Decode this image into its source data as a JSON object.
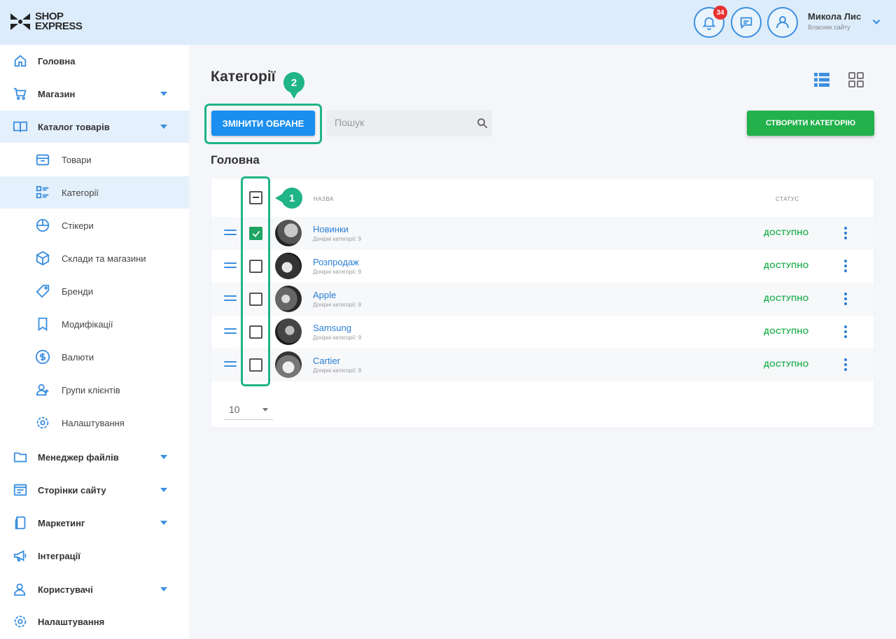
{
  "header": {
    "logo_line1": "SHOP",
    "logo_line2": "EXPRESS",
    "notifications_count": "34",
    "user_name": "Микола Лис",
    "user_subtitle": "Власник сайту",
    "icons": [
      "bell-icon",
      "chat-icon",
      "user-icon",
      "chevron-down-icon"
    ]
  },
  "sidebar": {
    "items": [
      {
        "label": "Головна",
        "icon": "home-icon"
      },
      {
        "label": "Магазин",
        "icon": "cart-icon",
        "expandable": true
      },
      {
        "label": "Каталог товарів",
        "icon": "book-icon",
        "expandable": true,
        "active": true
      },
      {
        "label": "Товари",
        "icon": "box-icon",
        "child": true
      },
      {
        "label": "Категорії",
        "icon": "category-list-icon",
        "child": true,
        "active": true
      },
      {
        "label": "Стікери",
        "icon": "sticker-icon",
        "child": true
      },
      {
        "label": "Склади та магазини",
        "icon": "warehouse-icon",
        "child": true
      },
      {
        "label": "Бренди",
        "icon": "tag-icon",
        "child": true
      },
      {
        "label": "Модифікації",
        "icon": "bookmark-icon",
        "child": true
      },
      {
        "label": "Валюти",
        "icon": "dollar-icon",
        "child": true
      },
      {
        "label": "Групи клієнтів",
        "icon": "user-group-icon",
        "child": true
      },
      {
        "label": "Налаштування",
        "icon": "gear-icon",
        "child": true
      },
      {
        "label": "Менеджер файлів",
        "icon": "folder-icon",
        "expandable": true
      },
      {
        "label": "Сторінки сайту",
        "icon": "pages-icon",
        "expandable": true
      },
      {
        "label": "Маркетинг",
        "icon": "marketing-icon",
        "expandable": true
      },
      {
        "label": "Інтеграції",
        "icon": "megaphone-icon"
      },
      {
        "label": "Користувачі",
        "icon": "users-icon",
        "expandable": true
      },
      {
        "label": "Налаштування",
        "icon": "gear-icon"
      }
    ]
  },
  "main": {
    "page_title": "Категорії",
    "edit_selected_label": "ЗМІНИТИ ОБРАНЕ",
    "search_placeholder": "Пошук",
    "create_label": "СТВОРИТИ КАТЕГОРІЮ",
    "section_title": "Головна",
    "columns": {
      "name": "НАЗВА",
      "status": "СТАТУС"
    },
    "rows": [
      {
        "name": "Новинки",
        "sub": "Дочірні категорії: 9",
        "status": "ДОСТУПНО",
        "checked": true
      },
      {
        "name": "Розпродаж",
        "sub": "Дочірні категорії: 9",
        "status": "ДОСТУПНО",
        "checked": false
      },
      {
        "name": "Apple",
        "sub": "Дочірні категорії: 9",
        "status": "ДОСТУПНО",
        "checked": false
      },
      {
        "name": "Samsung",
        "sub": "Дочірні категорії: 9",
        "status": "ДОСТУПНО",
        "checked": false
      },
      {
        "name": "Cartier",
        "sub": "Дочірні категорії: 9",
        "status": "ДОСТУПНО",
        "checked": false
      }
    ],
    "page_size": "10"
  },
  "annotations": {
    "marker_1": "1",
    "marker_2": "2",
    "color": "#20b486"
  },
  "colors": {
    "primary": "#1a8ff0",
    "create": "#22b14c",
    "status_ok": "#2db35a",
    "header_bg": "#dcecfb"
  }
}
